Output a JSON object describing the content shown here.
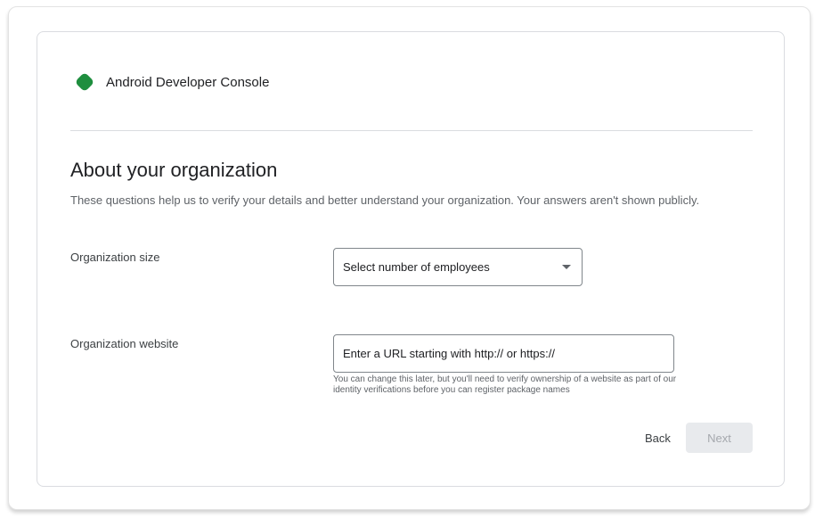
{
  "app": {
    "name": "Android Developer Console",
    "logo_icon": "green-diamond-logo-icon",
    "logo_color": "#1e8e3e"
  },
  "page": {
    "title": "About your organization",
    "subtitle": "These questions help us to verify your details and better understand your organization. Your answers aren't shown publicly."
  },
  "form": {
    "organization_size": {
      "label": "Organization size",
      "selected_value": "Select number of employees",
      "icon": "dropdown-arrow-icon"
    },
    "organization_website": {
      "label": "Organization website",
      "value": "",
      "placeholder": "Enter a URL starting with http:// or https://",
      "helper_text": "You can change this later, but you'll need to verify ownership of a website as part of our identity verifications before you can register package names"
    }
  },
  "actions": {
    "back_label": "Back",
    "next_label": "Next",
    "next_disabled": true
  }
}
